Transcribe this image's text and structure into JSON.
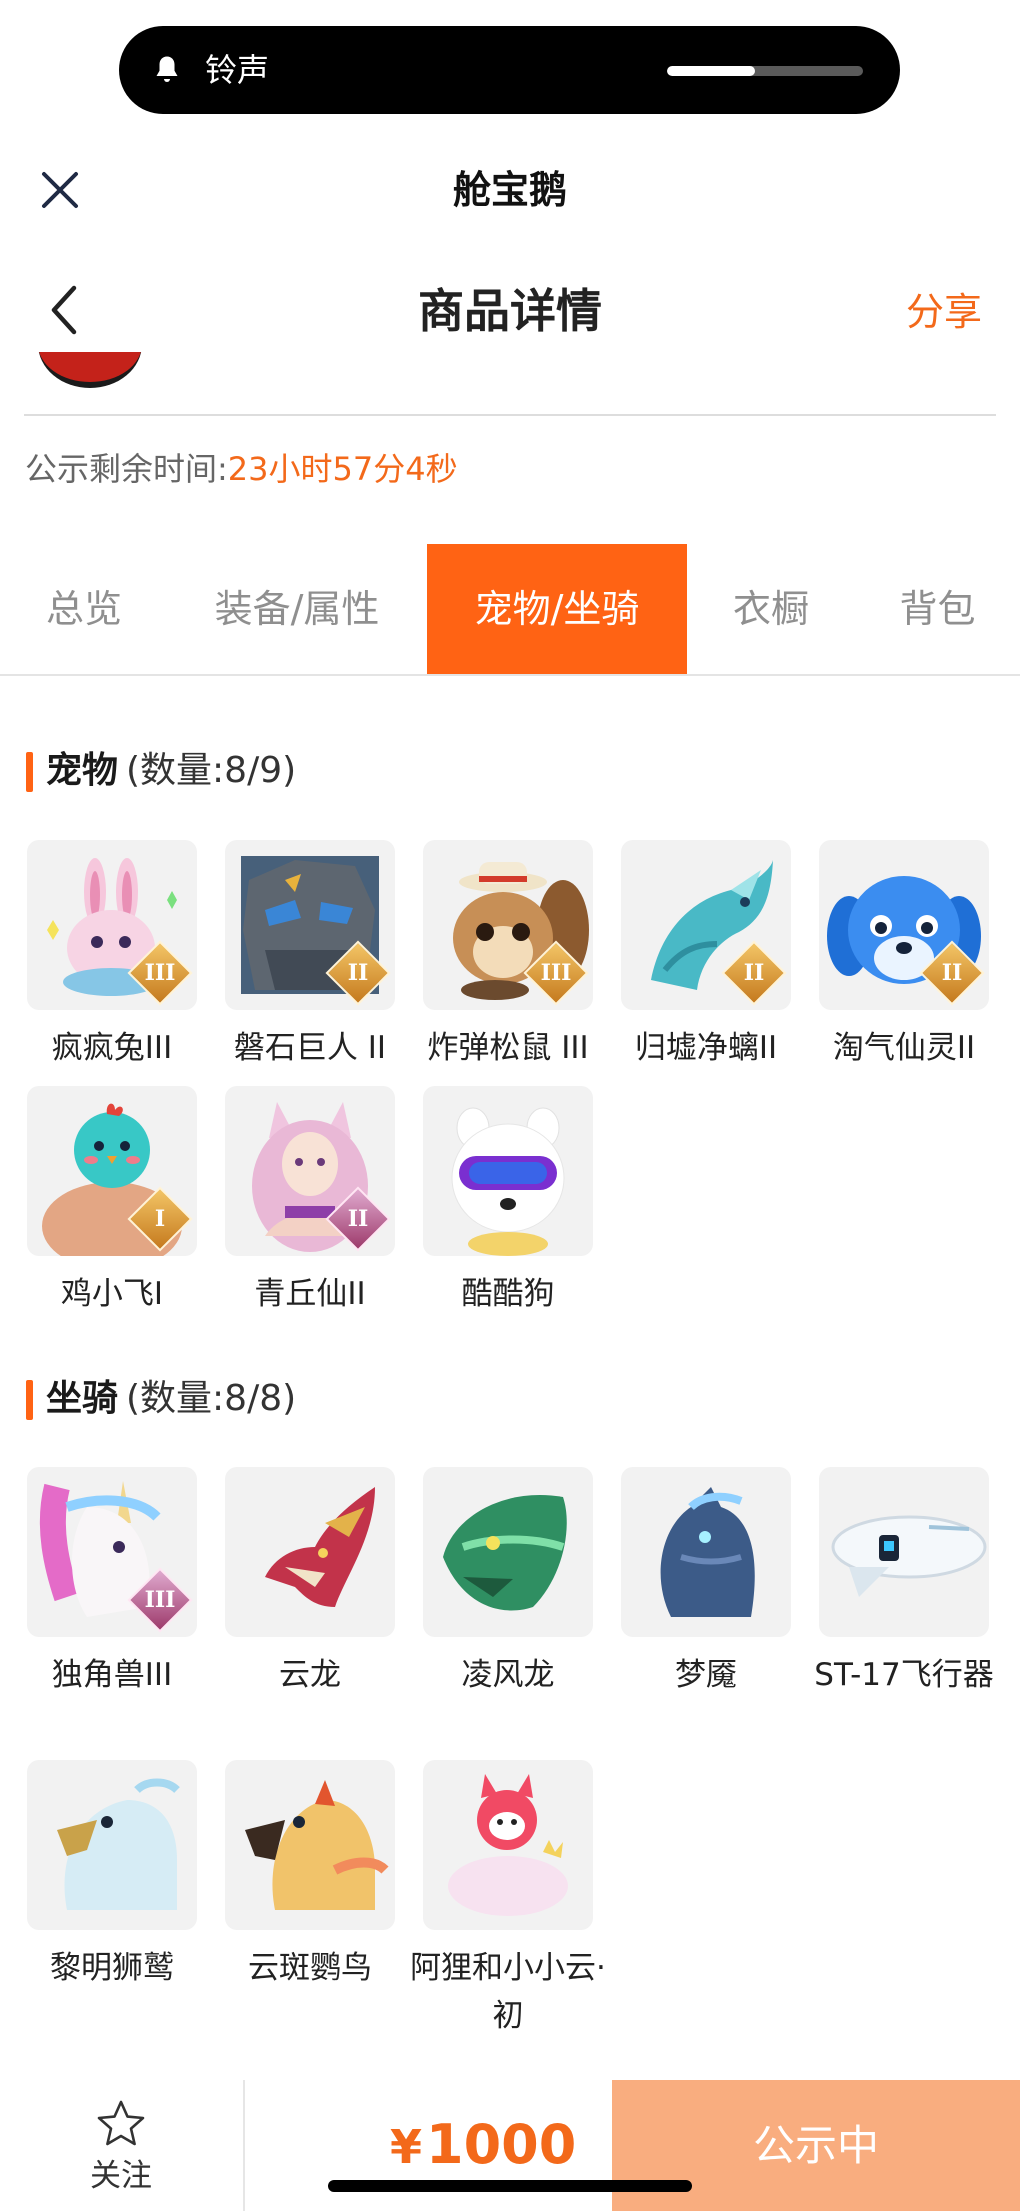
{
  "ringer": {
    "label": "铃声",
    "volume": 0.45
  },
  "header": {
    "app_title": "舱宝鹅",
    "page_title": "商品详情",
    "share_label": "分享"
  },
  "countdown": {
    "label": "公示剩余时间:",
    "value": "23小时57分4秒"
  },
  "tabs": [
    {
      "label": "总览",
      "active": false
    },
    {
      "label": "装备/属性",
      "active": false
    },
    {
      "label": "宠物/坐骑",
      "active": true
    },
    {
      "label": "衣橱",
      "active": false
    },
    {
      "label": "背包",
      "active": false
    }
  ],
  "pets": {
    "title": "宠物",
    "count": "(数量:8/9)",
    "items": [
      {
        "name": "疯疯兔III",
        "badge": "III"
      },
      {
        "name": "磐石巨人 II",
        "badge": "II"
      },
      {
        "name": "炸弹松鼠 III",
        "badge": "III"
      },
      {
        "name": "归墟净螭II",
        "badge": "II"
      },
      {
        "name": "淘气仙灵II",
        "badge": "II"
      },
      {
        "name": "鸡小飞I",
        "badge": "I"
      },
      {
        "name": "青丘仙II",
        "badge": "II"
      },
      {
        "name": "酷酷狗",
        "badge": ""
      }
    ]
  },
  "mounts": {
    "title": "坐骑",
    "count": "(数量:8/8)",
    "items": [
      {
        "name": "独角兽III",
        "badge": "III"
      },
      {
        "name": "云龙",
        "badge": ""
      },
      {
        "name": "凌风龙",
        "badge": ""
      },
      {
        "name": "梦魇",
        "badge": ""
      },
      {
        "name": "ST-17飞行器",
        "badge": ""
      },
      {
        "name": "黎明狮鹫",
        "badge": ""
      },
      {
        "name": "云斑鹦鸟",
        "badge": ""
      },
      {
        "name": "阿狸和小小云·初",
        "badge": ""
      }
    ]
  },
  "bottom": {
    "favorite_label": "关注",
    "currency": "¥",
    "price": "1000",
    "status_label": "公示中"
  },
  "colors": {
    "accent": "#ff6314",
    "accent_text": "#f3691a",
    "status_button": "#f9ad7f"
  },
  "icons": [
    "bell-icon",
    "close-icon",
    "back-chevron-icon",
    "star-icon"
  ]
}
